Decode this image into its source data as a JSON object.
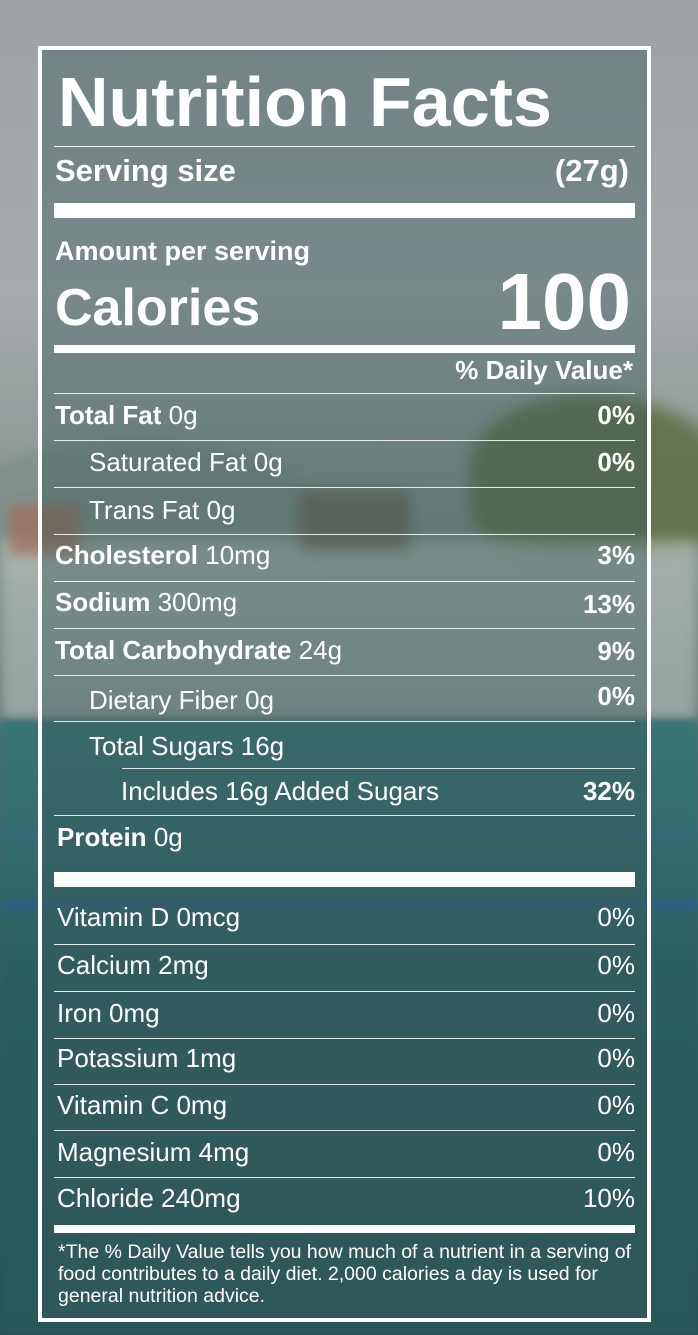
{
  "title": "Nutrition Facts",
  "serving": {
    "label": "Serving size",
    "value": "(27g)"
  },
  "calories": {
    "amount_label": "Amount per serving",
    "label": "Calories",
    "value": "100"
  },
  "daily_value_header": "% Daily Value*",
  "nutrients": [
    {
      "name": "Total Fat",
      "amount": "0g",
      "pct": "0%"
    },
    {
      "name": "Saturated Fat",
      "amount": "0g",
      "pct": "0%"
    },
    {
      "name": "Trans Fat",
      "amount": "0g",
      "pct": ""
    },
    {
      "name": "Cholesterol",
      "amount": "10mg",
      "pct": "3%"
    },
    {
      "name": "Sodium",
      "amount": "300mg",
      "pct": "13%"
    },
    {
      "name": "Total Carbohydrate",
      "amount": "24g",
      "pct": "9%"
    },
    {
      "name": "Dietary Fiber",
      "amount": "0g",
      "pct": "0%"
    },
    {
      "name": "Total Sugars",
      "amount": "16g",
      "pct": ""
    },
    {
      "name": "Includes 16g Added Sugars",
      "amount": "",
      "pct": "32%"
    },
    {
      "name": "Protein",
      "amount": "0g",
      "pct": ""
    }
  ],
  "vitamins": [
    {
      "name": "Vitamin D 0mcg",
      "pct": "0%"
    },
    {
      "name": "Calcium 2mg",
      "pct": "0%"
    },
    {
      "name": "Iron 0mg",
      "pct": "0%"
    },
    {
      "name": "Potassium 1mg",
      "pct": "0%"
    },
    {
      "name": "Vitamin C 0mg",
      "pct": "0%"
    },
    {
      "name": "Magnesium 4mg",
      "pct": "0%"
    },
    {
      "name": "Chloride 240mg",
      "pct": "10%"
    }
  ],
  "footnote": "*The % Daily Value tells you how much of a nutrient in a serving of food contributes to a daily diet. 2,000 calories a day is used for general nutrition advice.",
  "colors": {
    "text": "#ffffff",
    "panel_tint": "#3a5858",
    "water": "#2c5f60"
  }
}
